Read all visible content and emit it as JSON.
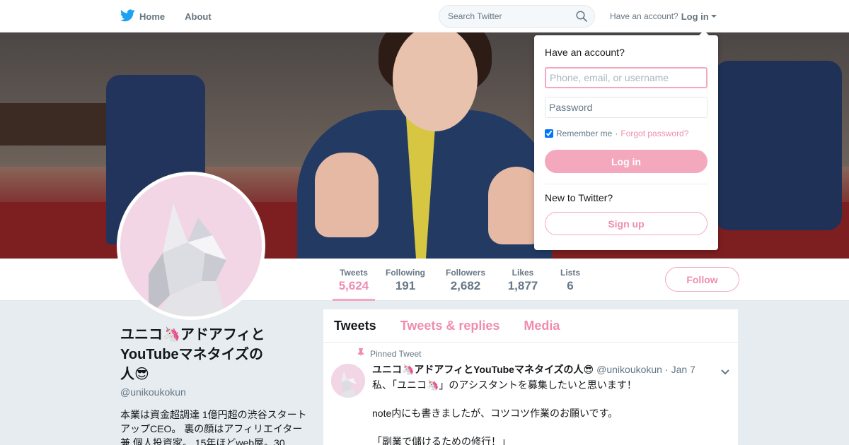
{
  "colors": {
    "accent": "#f08cb0",
    "accent_light": "#f4a8c0",
    "twitter_blue": "#1da1f2",
    "background": "#e6ecf0"
  },
  "nav": {
    "home_label": "Home",
    "home_icon": "twitter-bird-icon",
    "about_label": "About",
    "search_placeholder": "Search Twitter",
    "search_icon": "search-icon",
    "have_account": "Have an account?",
    "login_label": "Log in"
  },
  "login_dropdown": {
    "title": "Have an account?",
    "username_placeholder": "Phone, email, or username",
    "password_placeholder": "Password",
    "remember_label": "Remember me",
    "remember_checked": true,
    "separator": "·",
    "forgot_label": "Forgot password?",
    "login_button": "Log in",
    "new_label": "New to Twitter?",
    "signup_button": "Sign up"
  },
  "stats": [
    {
      "label": "Tweets",
      "value": "5,624",
      "active": true
    },
    {
      "label": "Following",
      "value": "191",
      "active": false
    },
    {
      "label": "Followers",
      "value": "2,682",
      "active": false
    },
    {
      "label": "Likes",
      "value": "1,877",
      "active": false
    },
    {
      "label": "Lists",
      "value": "6",
      "active": false
    }
  ],
  "follow_button": "Follow",
  "profile": {
    "name_line1": "ユニコ🦄アドアフィと",
    "name_line2": "YouTubeマネタイズの",
    "name_line3": "人😎",
    "handle": "@unikoukokun",
    "bio": "本業は資金超調達 1億円超の渋谷スタートアップCEO。 裏の顔はアフィリエイター兼 個人投資家。 15年ほどweb屋。30"
  },
  "timeline": {
    "tabs": [
      "Tweets",
      "Tweets & replies",
      "Media"
    ],
    "pinned_label": "Pinned Tweet",
    "pin_icon": "pin-icon",
    "tweet": {
      "name": "ユニコ🦄アドアフィとYouTubeマネタイズの人😎",
      "handle": "@unikoukokun",
      "separator": "·",
      "date": "Jan 7",
      "line1": "私、「ユニコ🦄」のアシスタントを募集したいと思います！",
      "line2": "note内にも書きましたが、コツコツ作業のお願いです。",
      "line3": "「副業で儲けるための修行！」"
    }
  }
}
